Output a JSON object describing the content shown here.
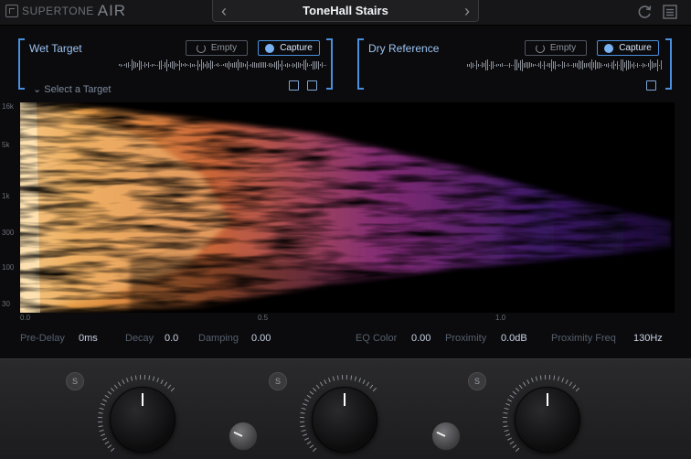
{
  "header": {
    "brand": "SUPERTONE",
    "product": "AIR",
    "preset_name": "ToneHall Stairs",
    "prev_icon": "chevron-left-icon",
    "next_icon": "chevron-right-icon"
  },
  "wet_panel": {
    "title": "Wet Target",
    "empty_label": "Empty",
    "capture_label": "Capture",
    "select_label": "Select a Target"
  },
  "dry_panel": {
    "title": "Dry Reference",
    "empty_label": "Empty",
    "capture_label": "Capture"
  },
  "spectrogram": {
    "y_ticks": [
      "16k",
      "5k",
      "1k",
      "300",
      "100",
      "30"
    ],
    "x_ticks": [
      "0.0",
      "0.5",
      "1.0"
    ]
  },
  "params": {
    "predelay_label": "Pre-Delay",
    "predelay_value": "0ms",
    "decay_label": "Decay",
    "decay_value": "0.0",
    "damping_label": "Damping",
    "damping_value": "0.00",
    "eqcolor_label": "EQ Color",
    "eqcolor_value": "0.00",
    "proximity_label": "Proximity",
    "proximity_value": "0.0dB",
    "proxfreq_label": "Proximity Freq",
    "proxfreq_value": "130Hz"
  },
  "knobs": {
    "solo_label": "S"
  },
  "colors": {
    "accent": "#4a8fdd",
    "background": "#0b0b0d"
  }
}
